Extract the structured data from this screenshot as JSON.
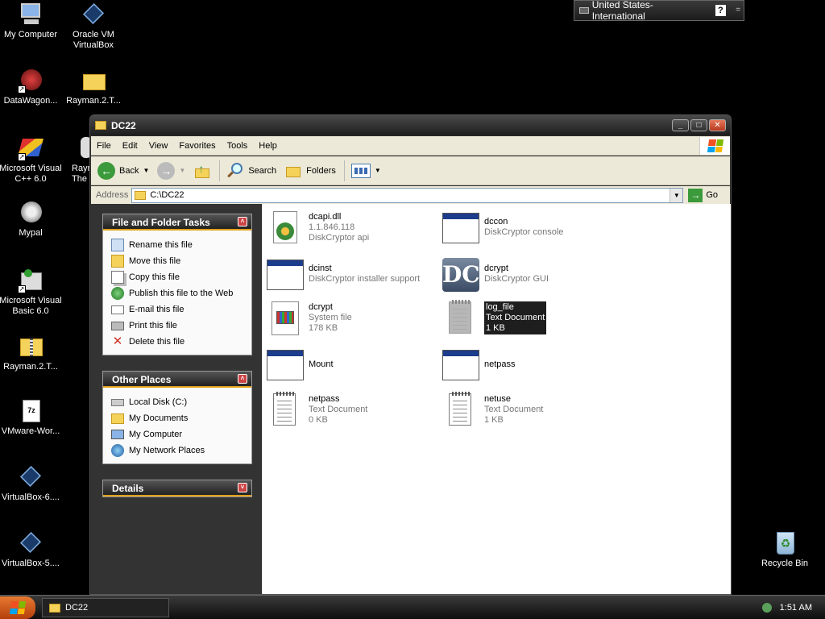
{
  "desktop": {
    "icons": [
      {
        "label": "My Computer",
        "icon": "my-computer-icon"
      },
      {
        "label": "Oracle VM VirtualBox",
        "icon": "virtualbox-icon"
      },
      {
        "label": "DataWagon...",
        "icon": "datawagon-icon"
      },
      {
        "label": "Rayman.2.T...",
        "icon": "folder-icon"
      },
      {
        "label": "Microsoft Visual C++ 6.0",
        "icon": "visual-cpp-icon"
      },
      {
        "label": "Raym The",
        "icon": "rayman-icon"
      },
      {
        "label": "Mypal",
        "icon": "mypal-icon"
      },
      {
        "label": "Microsoft Visual Basic 6.0",
        "icon": "visual-basic-icon"
      },
      {
        "label": "Rayman.2.T...",
        "icon": "zip-folder-icon"
      },
      {
        "label": "VMware-Wor...",
        "icon": "7z-archive-icon"
      },
      {
        "label": "VirtualBox-6....",
        "icon": "virtualbox-icon"
      },
      {
        "label": "VirtualBox-5....",
        "icon": "virtualbox-icon"
      },
      {
        "label": "Recycle Bin",
        "icon": "recycle-bin-icon"
      }
    ]
  },
  "langbar": {
    "language": "United States-International",
    "help": "?"
  },
  "window": {
    "title": "DC22",
    "menu": [
      "File",
      "Edit",
      "View",
      "Favorites",
      "Tools",
      "Help"
    ],
    "toolbar": {
      "back": "Back",
      "search": "Search",
      "folders": "Folders"
    },
    "address": {
      "label": "Address",
      "value": "C:\\DC22",
      "go": "Go"
    },
    "tasks": {
      "title": "File and Folder Tasks",
      "items": [
        "Rename this file",
        "Move this file",
        "Copy this file",
        "Publish this file to the Web",
        "E-mail this file",
        "Print this file",
        "Delete this file"
      ]
    },
    "places": {
      "title": "Other Places",
      "items": [
        "Local Disk (C:)",
        "My Documents",
        "My Computer",
        "My Network Places"
      ]
    },
    "details": {
      "title": "Details"
    },
    "files": [
      {
        "name": "dcapi.dll",
        "line2": "1.1.846.118",
        "line3": "DiskCryptor api",
        "kind": "dll"
      },
      {
        "name": "dccon",
        "line2": "DiskCryptor console",
        "line3": "",
        "kind": "app"
      },
      {
        "name": "dcinst",
        "line2": "DiskCryptor installer support",
        "line3": "",
        "kind": "app"
      },
      {
        "name": "dcrypt",
        "line2": "DiskCryptor GUI",
        "line3": "",
        "kind": "dc-gui"
      },
      {
        "name": "dcrypt",
        "line2": "System file",
        "line3": "178 KB",
        "kind": "sys"
      },
      {
        "name": "log_file",
        "line2": "Text Document",
        "line3": "1 KB",
        "kind": "txt",
        "selected": true
      },
      {
        "name": "Mount",
        "line2": "",
        "line3": "",
        "kind": "app"
      },
      {
        "name": "netpass",
        "line2": "",
        "line3": "",
        "kind": "app"
      },
      {
        "name": "netpass",
        "line2": "Text Document",
        "line3": "0 KB",
        "kind": "txt"
      },
      {
        "name": "netuse",
        "line2": "Text Document",
        "line3": "1 KB",
        "kind": "txt"
      }
    ]
  },
  "taskbar": {
    "task": "DC22",
    "clock": "1:51 AM"
  }
}
